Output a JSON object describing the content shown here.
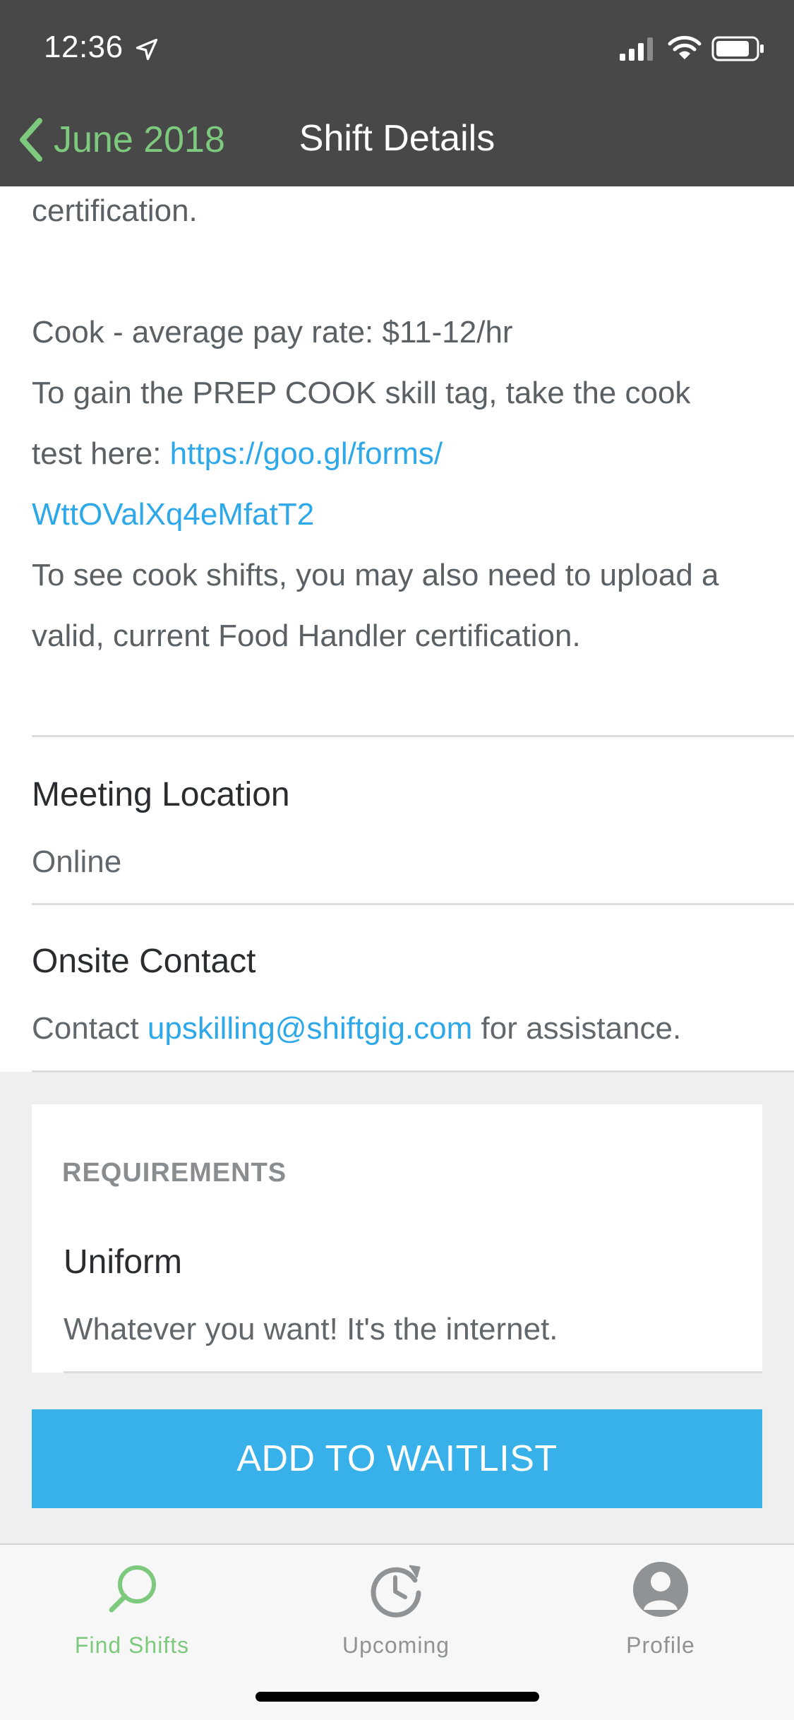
{
  "status_bar": {
    "time": "12:36"
  },
  "nav": {
    "back_label": "June 2018",
    "title": "Shift Details"
  },
  "description": {
    "line0": "certification.",
    "line1": "Cook - average pay rate: $11-12/hr",
    "line2": "To gain the PREP COOK skill tag, take the cook",
    "line3_prefix": "test here: ",
    "line3_link": "https://goo.gl/forms/",
    "line4_link": "WttOValXq4eMfatT2",
    "line5": "To see cook shifts, you may also need to upload a",
    "line6": "valid, current Food Handler certification."
  },
  "meeting_location": {
    "title": "Meeting Location",
    "value": "Online"
  },
  "onsite_contact": {
    "title": "Onsite Contact",
    "prefix": "Contact ",
    "email": "upskilling@shiftgig.com",
    "suffix": " for assistance."
  },
  "requirements": {
    "heading": "REQUIREMENTS",
    "items": [
      {
        "title": "Uniform",
        "value": "Whatever you want! It's the internet."
      }
    ]
  },
  "action": {
    "label": "ADD TO WAITLIST"
  },
  "tabbar": {
    "items": [
      {
        "label": "Find Shifts",
        "icon": "search-icon",
        "active": true
      },
      {
        "label": "Upcoming",
        "icon": "clock-history-icon",
        "active": false
      },
      {
        "label": "Profile",
        "icon": "profile-icon",
        "active": false
      }
    ]
  },
  "colors": {
    "accent_green": "#7dc97d",
    "link_blue": "#2ea8e8",
    "button_blue": "#38b0ea",
    "header_bg": "#484848"
  }
}
